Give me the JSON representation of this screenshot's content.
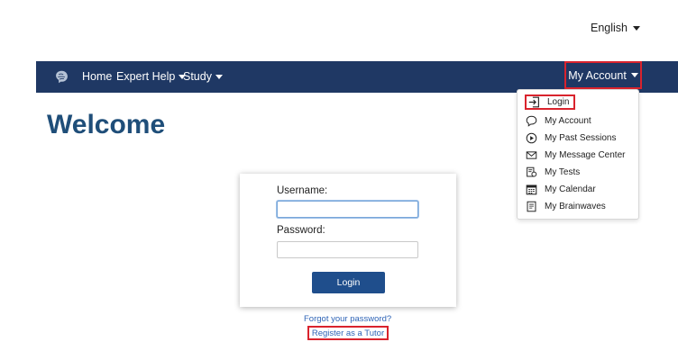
{
  "language": {
    "label": "English"
  },
  "nav": {
    "home": "Home",
    "expert_help": "Expert Help",
    "study": "Study",
    "my_account": "My Account"
  },
  "welcome": "Welcome",
  "account_menu": {
    "items": [
      {
        "label": "Login",
        "icon": "login-icon"
      },
      {
        "label": "My Account",
        "icon": "speech-bubble-icon"
      },
      {
        "label": "My Past Sessions",
        "icon": "play-circle-icon"
      },
      {
        "label": "My Message Center",
        "icon": "envelope-icon"
      },
      {
        "label": "My Tests",
        "icon": "test-badge-icon"
      },
      {
        "label": "My Calendar",
        "icon": "calendar-icon"
      },
      {
        "label": "My Brainwaves",
        "icon": "notepad-icon"
      }
    ]
  },
  "login_form": {
    "username_label": "Username:",
    "username_value": "",
    "password_label": "Password:",
    "password_value": "",
    "submit_label": "Login"
  },
  "links": {
    "forgot_password": "Forgot your password?",
    "register_tutor": "Register as a Tutor"
  },
  "colors": {
    "navbar": "#1f3864",
    "heading": "#1f4e79",
    "button": "#1f4e8c",
    "link": "#2f64b6",
    "highlight": "#d9232d"
  }
}
